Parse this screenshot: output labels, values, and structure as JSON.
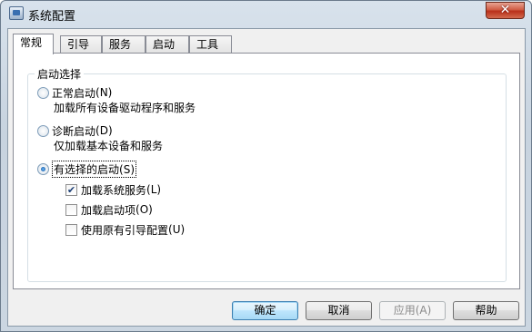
{
  "window": {
    "title": "系统配置",
    "close_glyph": "✕"
  },
  "tabs": [
    {
      "label": "常规",
      "active": true
    },
    {
      "label": "引导",
      "active": false
    },
    {
      "label": "服务",
      "active": false
    },
    {
      "label": "启动",
      "active": false
    },
    {
      "label": "工具",
      "active": false
    }
  ],
  "startup": {
    "group_label": "启动选择",
    "normal": {
      "label": "正常启动",
      "hotkey": "(N)",
      "desc": "加载所有设备驱动程序和服务",
      "checked": false
    },
    "diagnostic": {
      "label": "诊断启动",
      "hotkey": "(D)",
      "desc": "仅加载基本设备和服务",
      "checked": false
    },
    "selective": {
      "label": "有选择的启动",
      "hotkey": "(S)",
      "checked": true
    },
    "options": [
      {
        "label": "加载系统服务",
        "hotkey": "(L)",
        "checked": true
      },
      {
        "label": "加载启动项",
        "hotkey": "(O)",
        "checked": false
      },
      {
        "label": "使用原有引导配置",
        "hotkey": "(U)",
        "checked": false
      }
    ]
  },
  "buttons": {
    "ok": "确定",
    "cancel": "取消",
    "apply": "应用(A)",
    "help": "帮助"
  },
  "icons": {
    "window": "system-config-icon"
  },
  "colors": {
    "accent": "#3c7fb1",
    "close": "#c8432b"
  }
}
